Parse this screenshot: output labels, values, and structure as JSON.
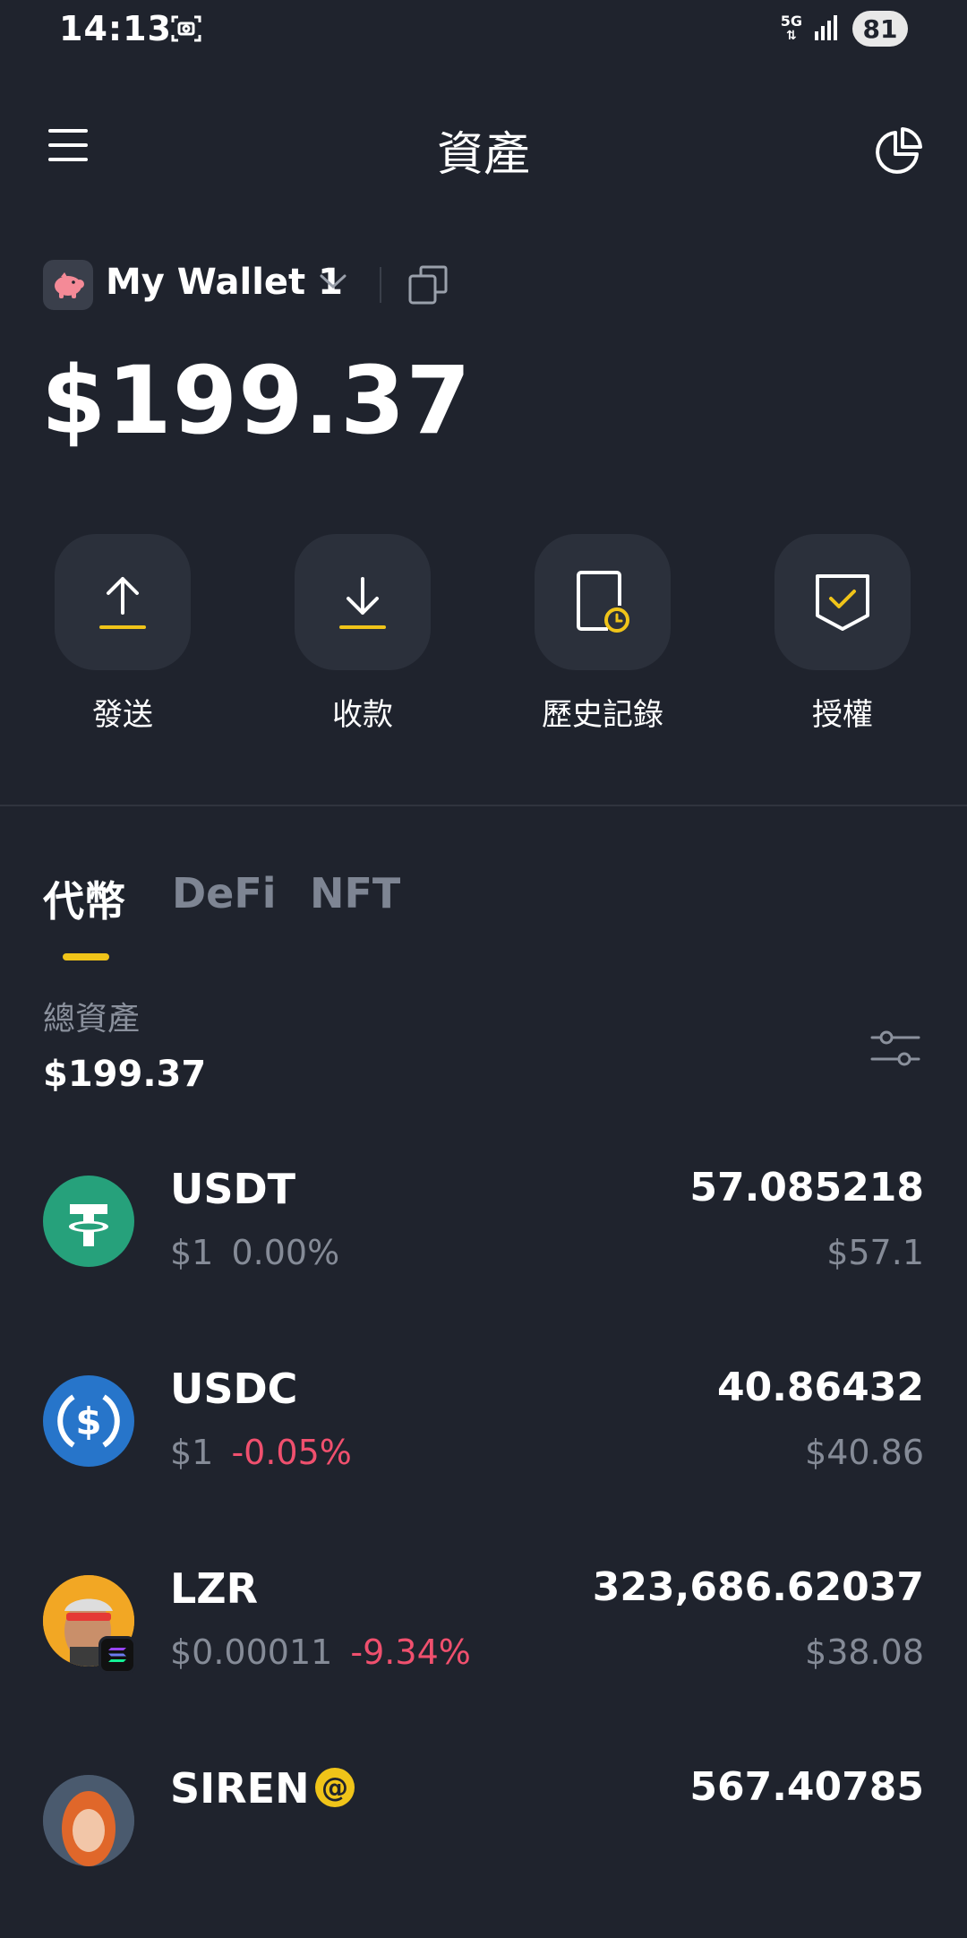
{
  "status_bar": {
    "time": "14:13",
    "network": "5G",
    "battery": "81"
  },
  "header": {
    "title": "資產"
  },
  "wallet": {
    "name": "My Wallet 1",
    "balance": "$199.37"
  },
  "actions": [
    {
      "label": "發送",
      "icon": "send-icon"
    },
    {
      "label": "收款",
      "icon": "receive-icon"
    },
    {
      "label": "歷史記錄",
      "icon": "history-icon"
    },
    {
      "label": "授權",
      "icon": "approval-icon"
    }
  ],
  "tabs": [
    {
      "label": "代幣",
      "active": true
    },
    {
      "label": "DeFi",
      "active": false
    },
    {
      "label": "NFT",
      "active": false
    }
  ],
  "summary": {
    "label": "總資產",
    "value": "$199.37"
  },
  "tokens": [
    {
      "symbol": "USDT",
      "price": "$1",
      "change": "0.00%",
      "change_color": "#858b97",
      "amount": "57.085218",
      "value": "$57.1"
    },
    {
      "symbol": "USDC",
      "price": "$1",
      "change": "-0.05%",
      "change_color": "#f0506e",
      "amount": "40.86432",
      "value": "$40.86"
    },
    {
      "symbol": "LZR",
      "price": "$0.00011",
      "change": "-9.34%",
      "change_color": "#f0506e",
      "amount": "323,686.62037",
      "value": "$38.08"
    },
    {
      "symbol": "SIREN",
      "price": "",
      "change": "",
      "change_color": "#858b97",
      "amount": "567.40785",
      "value": ""
    }
  ],
  "colors": {
    "background": "#1f232d",
    "accent": "#f0c419",
    "negative": "#f0506e",
    "muted": "#858b97"
  }
}
